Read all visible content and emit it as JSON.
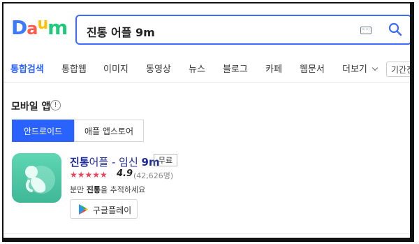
{
  "logo": {
    "letters": [
      "D",
      "a",
      "u",
      "m"
    ],
    "colors": [
      "#3b7bff",
      "#ff5a4b",
      "#ffc000",
      "#20c77d"
    ]
  },
  "search": {
    "query": "진통 어플 9m"
  },
  "tabs": [
    {
      "label": "통합검색",
      "active": true
    },
    {
      "label": "통합웹"
    },
    {
      "label": "이미지"
    },
    {
      "label": "동영상"
    },
    {
      "label": "뉴스"
    },
    {
      "label": "블로그"
    },
    {
      "label": "카페"
    },
    {
      "label": "웹문서"
    },
    {
      "label": "더보기"
    }
  ],
  "period_label": "기간전체",
  "section": {
    "title": "모바일 앱",
    "info": "!"
  },
  "segments": {
    "android": "안드로이드",
    "ios": "애플 앱스토어"
  },
  "app": {
    "name_highlight": "진통",
    "name_rest": "어플 - 임신",
    "name_suffix": "9m",
    "badge": "무료",
    "stars": "★★★★★",
    "rating": "4.9",
    "count": "(42,626명)",
    "desc_prefix": "분만 ",
    "desc_highlight": "진통",
    "desc_suffix": "을 추적하세요",
    "store_button": "구글플레이"
  },
  "colors": {
    "accent": "#2962ff",
    "search_border": "#3d6aff",
    "app_icon": "#4fc7a6",
    "stars": "#f0435a"
  }
}
